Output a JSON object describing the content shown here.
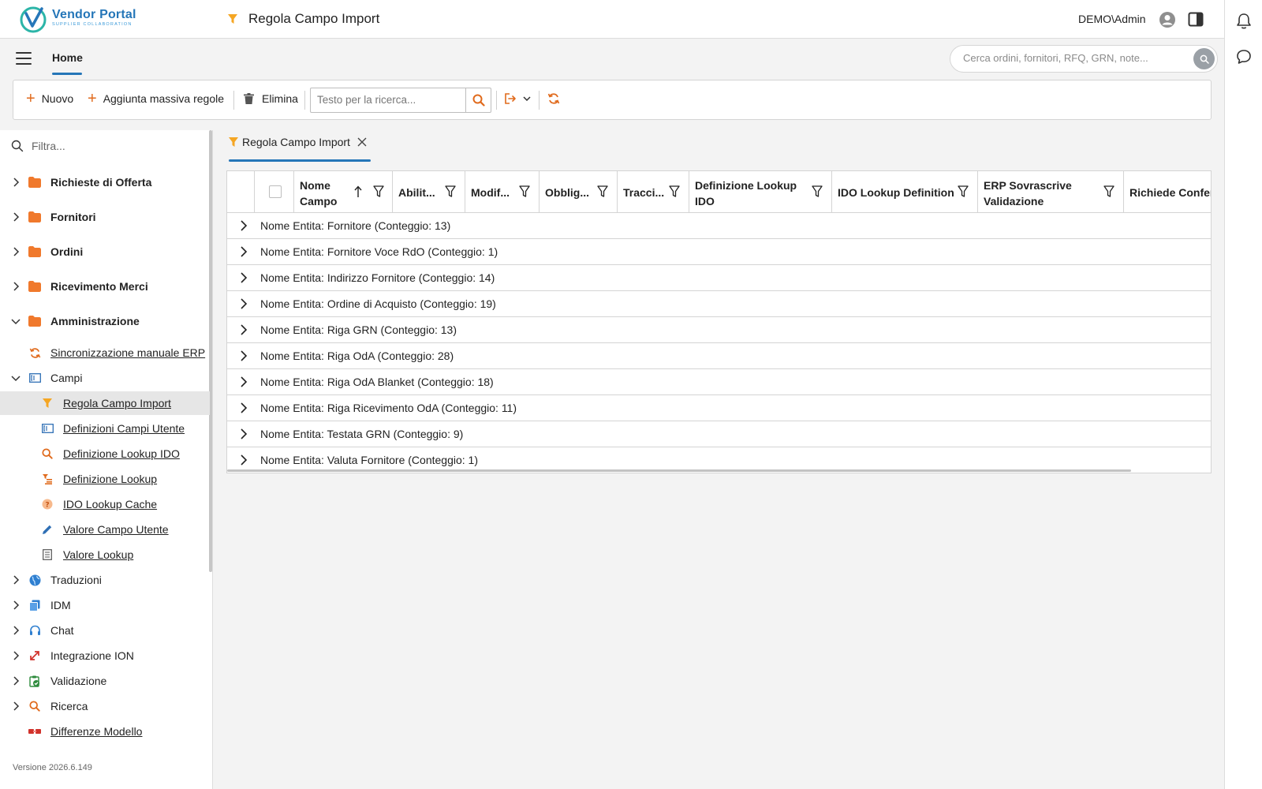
{
  "app": {
    "logo_title": "Vendor Portal",
    "logo_subtitle": "SUPPLIER COLLABORATION",
    "page_title": "Regola Campo Import",
    "user": "DEMO\\Admin"
  },
  "nav": {
    "home_tab": "Home",
    "search_placeholder": "Cerca ordini, fornitori, RFQ, GRN, note..."
  },
  "toolbar": {
    "new_label": "Nuovo",
    "bulk_add_label": "Aggiunta massiva regole",
    "delete_label": "Elimina",
    "search_placeholder": "Testo per la ricerca..."
  },
  "sidebar": {
    "filter_placeholder": "Filtra...",
    "items": [
      {
        "label": "Richieste di Offerta"
      },
      {
        "label": "Fornitori"
      },
      {
        "label": "Ordini"
      },
      {
        "label": "Ricevimento Merci"
      },
      {
        "label": "Amministrazione"
      },
      {
        "label": "Sincronizzazione manuale ERP"
      },
      {
        "label": "Campi"
      },
      {
        "label": "Regola Campo Import"
      },
      {
        "label": "Definizioni Campi Utente"
      },
      {
        "label": "Definizione Lookup IDO"
      },
      {
        "label": "Definizione Lookup"
      },
      {
        "label": "IDO Lookup Cache"
      },
      {
        "label": "Valore Campo Utente"
      },
      {
        "label": "Valore Lookup"
      },
      {
        "label": "Traduzioni"
      },
      {
        "label": "IDM"
      },
      {
        "label": "Chat"
      },
      {
        "label": "Integrazione ION"
      },
      {
        "label": "Validazione"
      },
      {
        "label": "Ricerca"
      },
      {
        "label": "Differenze Modello"
      }
    ],
    "version": "Versione 2026.6.149"
  },
  "content": {
    "tab_label": "Regola Campo Import",
    "columns": [
      {
        "line1": "Nome",
        "line2": "Campo"
      },
      {
        "line1": "Abilit...",
        "line2": ""
      },
      {
        "line1": "Modif...",
        "line2": ""
      },
      {
        "line1": "Obblig...",
        "line2": ""
      },
      {
        "line1": "Tracci...",
        "line2": ""
      },
      {
        "line1": "Definizione Lookup",
        "line2": "IDO"
      },
      {
        "line1": "IDO Lookup Definition",
        "line2": ""
      },
      {
        "line1": "ERP Sovrascrive",
        "line2": "Validazione"
      },
      {
        "line1": "Richiede Confer",
        "line2": ""
      }
    ],
    "groups": [
      "Nome Entita: Fornitore (Conteggio: 13)",
      "Nome Entita: Fornitore Voce RdO (Conteggio: 1)",
      "Nome Entita: Indirizzo Fornitore (Conteggio: 14)",
      "Nome Entita: Ordine di Acquisto (Conteggio: 19)",
      "Nome Entita: Riga GRN (Conteggio: 13)",
      "Nome Entita: Riga OdA (Conteggio: 28)",
      "Nome Entita: Riga OdA Blanket (Conteggio: 18)",
      "Nome Entita: Riga Ricevimento OdA (Conteggio: 11)",
      "Nome Entita: Testata GRN (Conteggio: 9)",
      "Nome Entita: Valuta Fornitore (Conteggio: 1)"
    ]
  },
  "colors": {
    "accent": "#2576b8",
    "orange": "#e06a1c",
    "funnel": "#f5a623"
  }
}
